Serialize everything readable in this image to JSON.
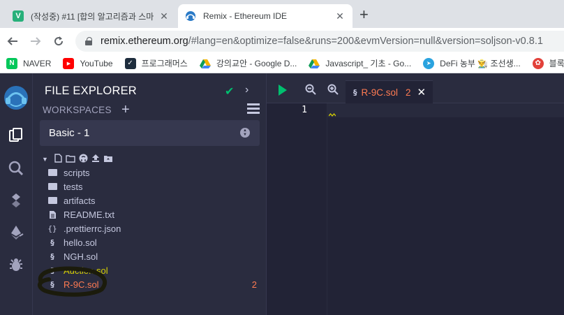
{
  "browser": {
    "tabs": [
      {
        "title": "(작성중) #11 [합의 알고리즘과 스마",
        "favicon": "V",
        "active": false,
        "close": "✕"
      },
      {
        "title": "Remix - Ethereum IDE",
        "favicon": "remix-logo",
        "active": true,
        "close": "✕"
      }
    ],
    "new_tab_label": "+",
    "url_host": "remix.ethereum.org",
    "url_path": "/#lang=en&optimize=false&runs=200&evmVersion=null&version=soljson-v0.8.1",
    "bookmarks": [
      {
        "label": "NAVER",
        "icon": "naver-icon",
        "color": "#03c75a",
        "glyph": "N"
      },
      {
        "label": "YouTube",
        "icon": "youtube-icon",
        "color": "#ff0000",
        "glyph": "▶"
      },
      {
        "label": "프로그래머스",
        "icon": "programmers-icon",
        "color": "#1e2d3d",
        "glyph": "✓"
      },
      {
        "label": "강의교안 - Google D...",
        "icon": "google-drive-icon",
        "color": "#f4b400",
        "glyph": "▲"
      },
      {
        "label": "Javascript_ 기초 - Go...",
        "icon": "google-drive-icon",
        "color": "#0f9d58",
        "glyph": "▲"
      },
      {
        "label": "DeFi 농부 👨‍🌾 조선생...",
        "icon": "telegram-icon",
        "color": "#2aa3df",
        "glyph": "➤"
      },
      {
        "label": "블록",
        "icon": "flower-icon",
        "color": "#e2413a",
        "glyph": "✿"
      }
    ]
  },
  "remix": {
    "file_explorer": {
      "title": "FILE EXPLORER",
      "workspaces_label": "WORKSPACES",
      "workspace_selected": "Basic - 1",
      "items": [
        {
          "label": "scripts",
          "type": "folder",
          "status": "normal",
          "badge": ""
        },
        {
          "label": "tests",
          "type": "folder",
          "status": "normal",
          "badge": ""
        },
        {
          "label": "artifacts",
          "type": "folder",
          "status": "normal",
          "badge": ""
        },
        {
          "label": "README.txt",
          "type": "file",
          "status": "normal",
          "badge": ""
        },
        {
          "label": ".prettierrc.json",
          "type": "json",
          "status": "normal",
          "badge": ""
        },
        {
          "label": "hello.sol",
          "type": "sol",
          "status": "normal",
          "badge": ""
        },
        {
          "label": "NGH.sol",
          "type": "sol",
          "status": "normal",
          "badge": ""
        },
        {
          "label": "Auction.sol",
          "type": "sol",
          "status": "warning",
          "badge": ""
        },
        {
          "label": "R-9C.sol",
          "type": "sol",
          "status": "error",
          "badge": "2"
        }
      ]
    },
    "editor": {
      "tab_name": "R-9C.sol",
      "tab_error_count": "2",
      "line_number": "1"
    },
    "colors": {
      "accent_green": "#00bf6f",
      "error": "#ff7b52",
      "warning": "#d7d000",
      "panel": "#2a2c3f",
      "editor_bg": "#222336"
    }
  }
}
